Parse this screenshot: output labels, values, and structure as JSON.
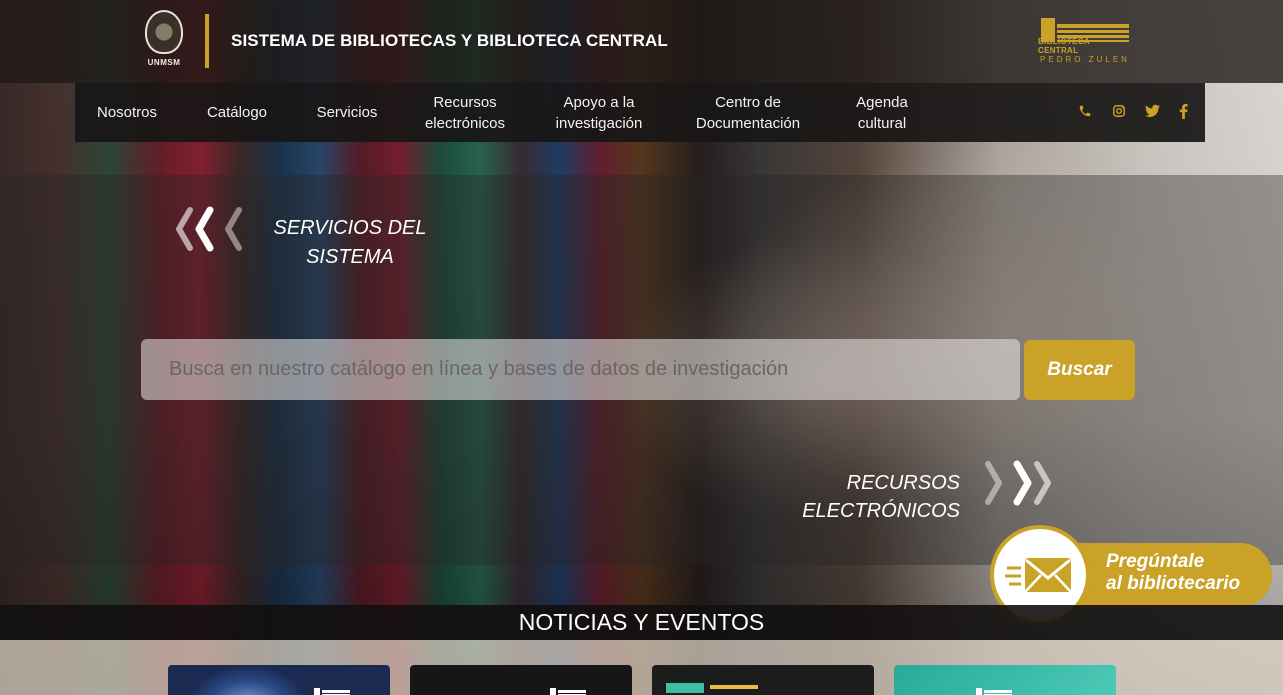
{
  "header": {
    "university_label": "UNMSM",
    "site_title": "SISTEMA DE BIBLIOTECAS Y BIBLIOTECA CENTRAL",
    "library_logo_line1": "BIBLIOTECA CENTRAL",
    "library_logo_line2": "PEDRO ZULEN"
  },
  "nav": {
    "items": [
      {
        "label": "Nosotros"
      },
      {
        "label": "Catálogo"
      },
      {
        "label": "Servicios"
      },
      {
        "label": "Recursos electrónicos"
      },
      {
        "label": "Apoyo a la investigación"
      },
      {
        "label": "Centro de Documentación"
      },
      {
        "label": "Agenda cultural"
      }
    ],
    "social_icons": [
      "phone-icon",
      "instagram-icon",
      "twitter-icon",
      "facebook-icon"
    ]
  },
  "hero": {
    "services_label": "SERVICIOS DEL SISTEMA",
    "search_placeholder": "Busca en nuestro catálogo en línea y bases de datos de investigación",
    "search_button": "Buscar",
    "resources_label": "RECURSOS ELECTRÓNICOS"
  },
  "ask_librarian": {
    "line1": "Pregúntale",
    "line2": "al bibliotecario"
  },
  "news": {
    "title": "NOTICIAS Y EVENTOS"
  },
  "colors": {
    "accent_gold": "#c9a227",
    "nav_background": "#181616",
    "text_white": "#ffffff"
  }
}
